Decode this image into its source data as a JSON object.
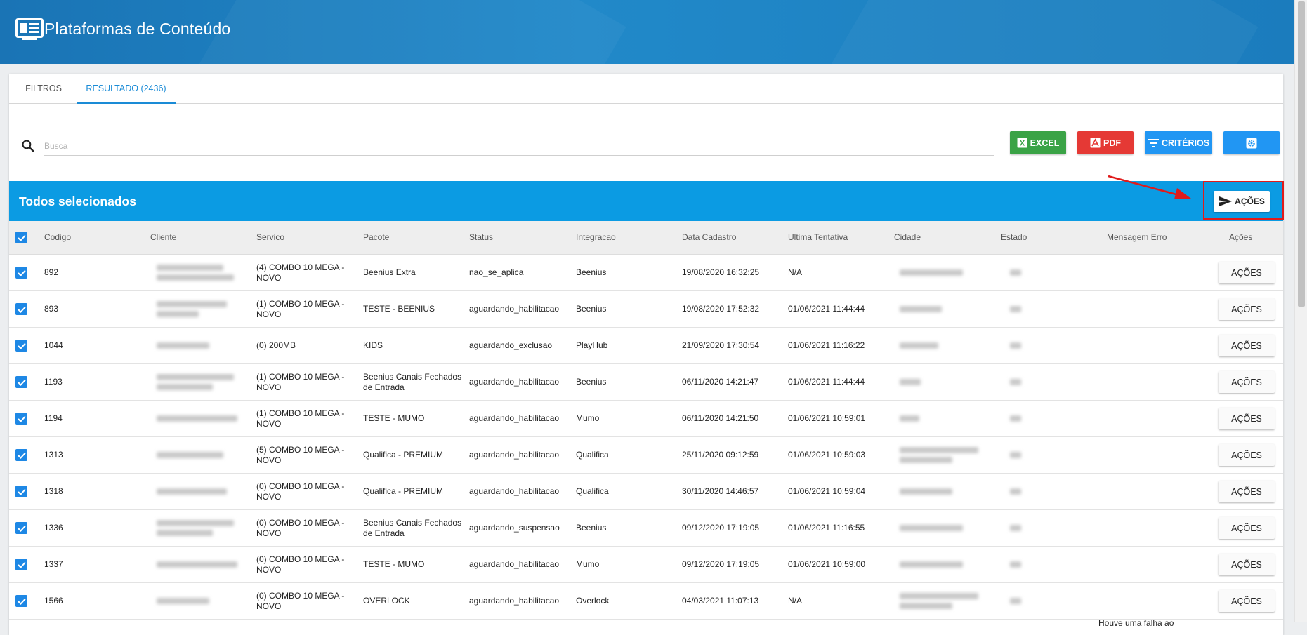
{
  "app": {
    "title": "Plataformas de Conteúdo",
    "logo_icon": "monitor-grid-icon"
  },
  "tabs": [
    {
      "label": "FILTROS",
      "active": false
    },
    {
      "label": "RESULTADO (2436)",
      "active": true
    }
  ],
  "search": {
    "placeholder": "Busca",
    "value": ""
  },
  "toolbar": {
    "excel_label": "EXCEL",
    "pdf_label": "PDF",
    "criterios_label": "CRITÉRIOS",
    "config_icon": "settings-gear-icon"
  },
  "selection_bar": {
    "title": "Todos selecionados",
    "actions_label": "AÇÕES"
  },
  "table": {
    "columns": [
      "Codigo",
      "Cliente",
      "Servico",
      "Pacote",
      "Status",
      "Integracao",
      "Data Cadastro",
      "Ultima Tentativa",
      "Cidade",
      "Estado",
      "Mensagem Erro",
      "Ações"
    ],
    "action_label": "AÇÕES",
    "rows": [
      {
        "codigo": "892",
        "servico": "(4) COMBO 10 MEGA - NOVO",
        "pacote": "Beenius Extra",
        "status": "nao_se_aplica",
        "integracao": "Beenius",
        "data_cadastro": "19/08/2020 16:32:25",
        "ultima_tentativa": "N/A",
        "mensagem_erro": ""
      },
      {
        "codigo": "893",
        "servico": "(1) COMBO 10 MEGA - NOVO",
        "pacote": "TESTE - BEENIUS",
        "status": "aguardando_habilitacao",
        "integracao": "Beenius",
        "data_cadastro": "19/08/2020 17:52:32",
        "ultima_tentativa": "01/06/2021 11:44:44",
        "mensagem_erro": ""
      },
      {
        "codigo": "1044",
        "servico": "(0) 200MB",
        "pacote": "KIDS",
        "status": "aguardando_exclusao",
        "integracao": "PlayHub",
        "data_cadastro": "21/09/2020 17:30:54",
        "ultima_tentativa": "01/06/2021 11:16:22",
        "mensagem_erro": ""
      },
      {
        "codigo": "1193",
        "servico": "(1) COMBO 10 MEGA - NOVO",
        "pacote": "Beenius Canais Fechados de Entrada",
        "status": "aguardando_habilitacao",
        "integracao": "Beenius",
        "data_cadastro": "06/11/2020 14:21:47",
        "ultima_tentativa": "01/06/2021 11:44:44",
        "mensagem_erro": ""
      },
      {
        "codigo": "1194",
        "servico": "(1) COMBO 10 MEGA - NOVO",
        "pacote": "TESTE - MUMO",
        "status": "aguardando_habilitacao",
        "integracao": "Mumo",
        "data_cadastro": "06/11/2020 14:21:50",
        "ultima_tentativa": "01/06/2021 10:59:01",
        "mensagem_erro": ""
      },
      {
        "codigo": "1313",
        "servico": "(5) COMBO 10 MEGA - NOVO",
        "pacote": "Qualifica - PREMIUM",
        "status": "aguardando_habilitacao",
        "integracao": "Qualifica",
        "data_cadastro": "25/11/2020 09:12:59",
        "ultima_tentativa": "01/06/2021 10:59:03",
        "mensagem_erro": ""
      },
      {
        "codigo": "1318",
        "servico": "(0) COMBO 10 MEGA - NOVO",
        "pacote": "Qualifica - PREMIUM",
        "status": "aguardando_habilitacao",
        "integracao": "Qualifica",
        "data_cadastro": "30/11/2020 14:46:57",
        "ultima_tentativa": "01/06/2021 10:59:04",
        "mensagem_erro": ""
      },
      {
        "codigo": "1336",
        "servico": "(0) COMBO 10 MEGA - NOVO",
        "pacote": "Beenius Canais Fechados de Entrada",
        "status": "aguardando_suspensao",
        "integracao": "Beenius",
        "data_cadastro": "09/12/2020 17:19:05",
        "ultima_tentativa": "01/06/2021 11:16:55",
        "mensagem_erro": ""
      },
      {
        "codigo": "1337",
        "servico": "(0) COMBO 10 MEGA - NOVO",
        "pacote": "TESTE - MUMO",
        "status": "aguardando_habilitacao",
        "integracao": "Mumo",
        "data_cadastro": "09/12/2020 17:19:05",
        "ultima_tentativa": "01/06/2021 10:59:00",
        "mensagem_erro": ""
      },
      {
        "codigo": "1566",
        "servico": "(0) COMBO 10 MEGA - NOVO",
        "pacote": "OVERLOCK",
        "status": "aguardando_habilitacao",
        "integracao": "Overlock",
        "data_cadastro": "04/03/2021 11:07:13",
        "ultima_tentativa": "N/A",
        "mensagem_erro": ""
      }
    ],
    "next_row_partial_message": "Houve uma falha ao"
  },
  "colors": {
    "header_bg": "#1f84c6",
    "selection_bar_bg": "#0b9be3",
    "excel_green": "#3aa346",
    "pdf_red": "#e53935",
    "primary_blue": "#2196f3",
    "annotation_red": "#e01b1b"
  }
}
